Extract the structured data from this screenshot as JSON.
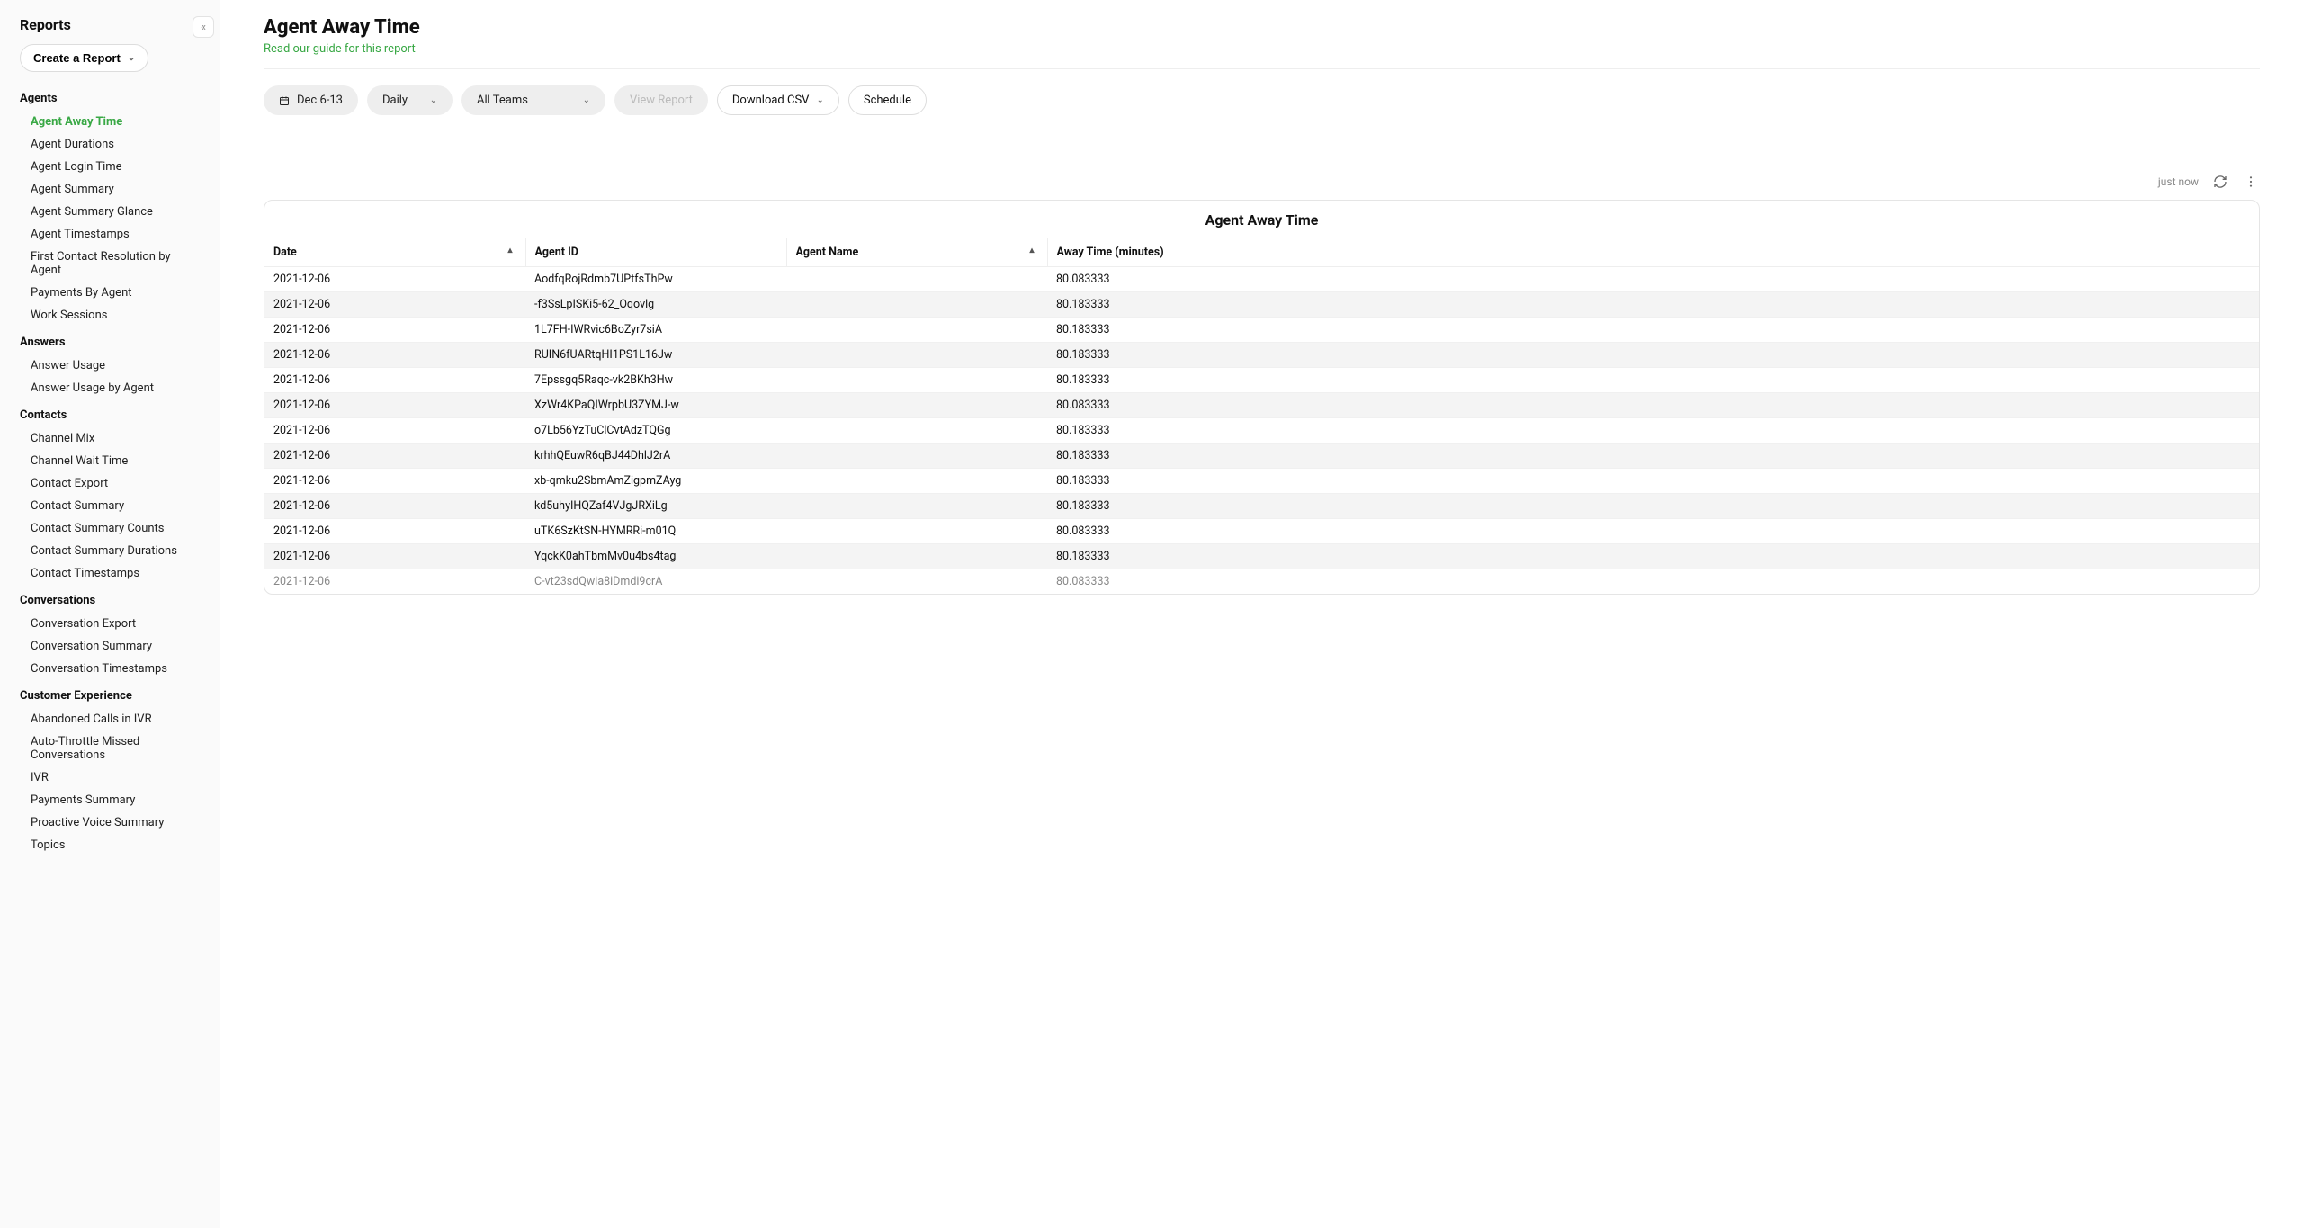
{
  "sidebar": {
    "title": "Reports",
    "create_label": "Create a Report",
    "sections": [
      {
        "title": "Agents",
        "items": [
          {
            "label": "Agent Away Time",
            "active": true
          },
          {
            "label": "Agent Durations"
          },
          {
            "label": "Agent Login Time"
          },
          {
            "label": "Agent Summary"
          },
          {
            "label": "Agent Summary Glance"
          },
          {
            "label": "Agent Timestamps"
          },
          {
            "label": "First Contact Resolution by Agent"
          },
          {
            "label": "Payments By Agent"
          },
          {
            "label": "Work Sessions"
          }
        ]
      },
      {
        "title": "Answers",
        "items": [
          {
            "label": "Answer Usage"
          },
          {
            "label": "Answer Usage by Agent"
          }
        ]
      },
      {
        "title": "Contacts",
        "items": [
          {
            "label": "Channel Mix"
          },
          {
            "label": "Channel Wait Time"
          },
          {
            "label": "Contact Export"
          },
          {
            "label": "Contact Summary"
          },
          {
            "label": "Contact Summary Counts"
          },
          {
            "label": "Contact Summary Durations"
          },
          {
            "label": "Contact Timestamps"
          }
        ]
      },
      {
        "title": "Conversations",
        "items": [
          {
            "label": "Conversation Export"
          },
          {
            "label": "Conversation Summary"
          },
          {
            "label": "Conversation Timestamps"
          }
        ]
      },
      {
        "title": "Customer Experience",
        "items": [
          {
            "label": "Abandoned Calls in IVR"
          },
          {
            "label": "Auto-Throttle Missed Conversations"
          },
          {
            "label": "IVR"
          },
          {
            "label": "Payments Summary"
          },
          {
            "label": "Proactive Voice Summary"
          },
          {
            "label": "Topics"
          }
        ]
      }
    ]
  },
  "header": {
    "title": "Agent Away Time",
    "subtitle": "Read our guide for this report"
  },
  "toolbar": {
    "date_label": "Dec 6-13",
    "interval_label": "Daily",
    "teams_label": "All Teams",
    "view_label": "View Report",
    "download_label": "Download CSV",
    "schedule_label": "Schedule"
  },
  "meta": {
    "updated_label": "just now"
  },
  "table": {
    "title": "Agent Away Time",
    "columns": [
      "Date",
      "Agent ID",
      "Agent Name",
      "Away Time (minutes)"
    ],
    "rows": [
      {
        "date": "2021-12-06",
        "agent_id": "AodfqRojRdmb7UPtfsThPw",
        "agent_name": "",
        "away": "80.083333"
      },
      {
        "date": "2021-12-06",
        "agent_id": "-f3SsLpISKi5-62_Oqovlg",
        "agent_name": "",
        "away": "80.183333"
      },
      {
        "date": "2021-12-06",
        "agent_id": "1L7FH-IWRvic6BoZyr7siA",
        "agent_name": "",
        "away": "80.183333"
      },
      {
        "date": "2021-12-06",
        "agent_id": "RUIN6fUARtqHI1PS1L16Jw",
        "agent_name": "",
        "away": "80.183333"
      },
      {
        "date": "2021-12-06",
        "agent_id": "7Epssgq5Raqc-vk2BKh3Hw",
        "agent_name": "",
        "away": "80.183333"
      },
      {
        "date": "2021-12-06",
        "agent_id": "XzWr4KPaQIWrpbU3ZYMJ-w",
        "agent_name": "",
        "away": "80.083333"
      },
      {
        "date": "2021-12-06",
        "agent_id": "o7Lb56YzTuClCvtAdzTQGg",
        "agent_name": "",
        "away": "80.183333"
      },
      {
        "date": "2021-12-06",
        "agent_id": "krhhQEuwR6qBJ44DhlJ2rA",
        "agent_name": "",
        "away": "80.183333"
      },
      {
        "date": "2021-12-06",
        "agent_id": "xb-qmku2SbmAmZigpmZAyg",
        "agent_name": "",
        "away": "80.183333"
      },
      {
        "date": "2021-12-06",
        "agent_id": "kd5uhyIHQZaf4VJgJRXiLg",
        "agent_name": "",
        "away": "80.183333"
      },
      {
        "date": "2021-12-06",
        "agent_id": "uTK6SzKtSN-HYMRRi-m01Q",
        "agent_name": "",
        "away": "80.083333"
      },
      {
        "date": "2021-12-06",
        "agent_id": "YqckK0ahTbmMv0u4bs4tag",
        "agent_name": "",
        "away": "80.183333"
      },
      {
        "date": "2021-12-06",
        "agent_id": "C-vt23sdQwia8iDmdi9crA",
        "agent_name": "",
        "away": "80.083333"
      }
    ]
  }
}
